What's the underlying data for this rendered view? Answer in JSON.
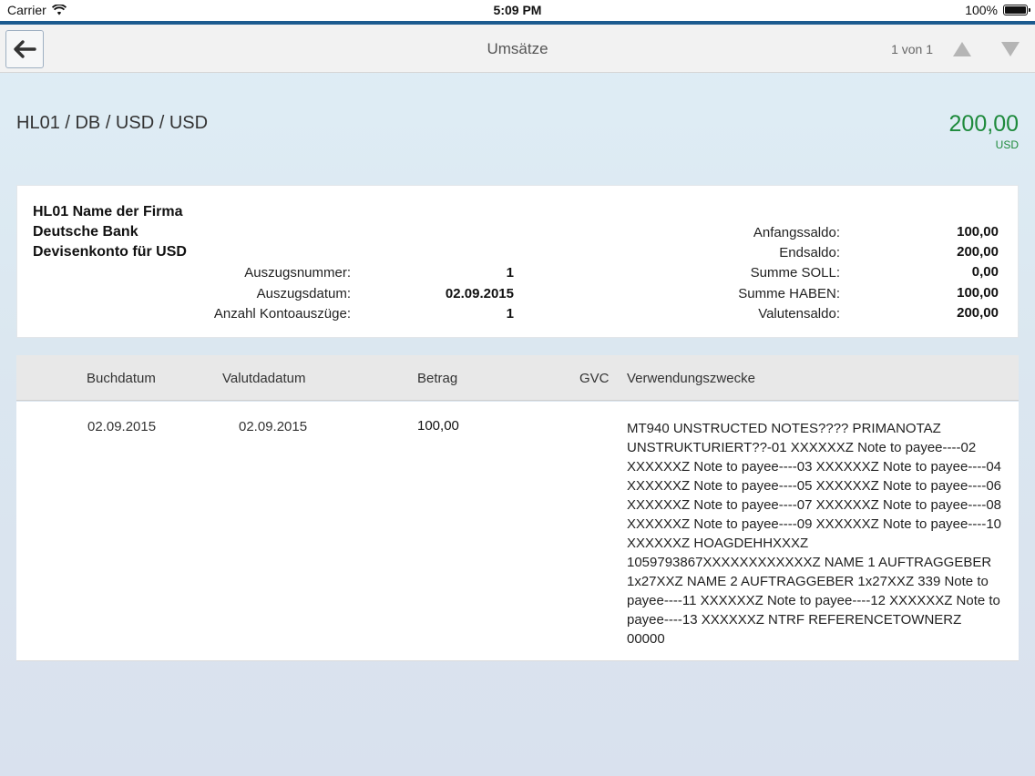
{
  "status_bar": {
    "carrier": "Carrier",
    "time": "5:09 PM",
    "battery": "100%"
  },
  "nav": {
    "title": "Umsätze",
    "pager": "1 von 1"
  },
  "header": {
    "account": "HL01 / DB / USD / USD",
    "amount": "200,00",
    "currency": "USD"
  },
  "info": {
    "firm_lines": [
      "HL01 Name der Firma",
      "Deutsche Bank",
      "Devisenkonto für USD"
    ],
    "left_fields": [
      {
        "label": "Auszugsnummer:",
        "value": "1"
      },
      {
        "label": "Auszugsdatum:",
        "value": "02.09.2015"
      },
      {
        "label": "Anzahl Kontoauszüge:",
        "value": "1"
      }
    ],
    "right_fields": [
      {
        "label": "Anfangssaldo:",
        "value": "100,00"
      },
      {
        "label": "Endsaldo:",
        "value": "200,00"
      },
      {
        "label": "Summe SOLL:",
        "value": "0,00"
      },
      {
        "label": "Summe HABEN:",
        "value": "100,00"
      },
      {
        "label": "Valutensaldo:",
        "value": "200,00"
      }
    ]
  },
  "table": {
    "columns": [
      "Buchdatum",
      "Valutdadatum",
      "Betrag",
      "GVC",
      "Verwendungszwecke"
    ],
    "rows": [
      {
        "buchdatum": "02.09.2015",
        "valutdatum": "02.09.2015",
        "betrag": "100,00",
        "gvc": "",
        "verwendungszweck": "MT940 UNSTRUCTED NOTES???? PRIMANOTAZ UNSTRUKTURIERT??-01 XXXXXXZ Note to payee----02 XXXXXXZ Note to payee----03 XXXXXXZ Note to payee----04 XXXXXXZ Note to payee----05 XXXXXXZ Note to payee----06 XXXXXXZ Note to payee----07 XXXXXXZ Note to payee----08 XXXXXXZ Note to payee----09 XXXXXXZ Note to payee----10 XXXXXXZ HOAGDEHHXXXZ 1059793867XXXXXXXXXXXXZ NAME 1 AUFTRAGGEBER 1x27XXZ NAME 2 AUFTRAGGEBER 1x27XXZ 339 Note to payee----11 XXXXXXZ Note to payee----12 XXXXXXZ Note to payee----13 XXXXXXZ NTRF REFERENCETOWNERZ 00000"
      }
    ]
  },
  "icons": {
    "back": "arrow-left-icon",
    "prev": "triangle-up-icon",
    "next": "triangle-down-icon",
    "wifi": "wifi-icon",
    "battery": "battery-icon"
  },
  "colors": {
    "accent": "#1c5b8f",
    "amount": "#1e8a3c",
    "arrows_disabled": "#b5b5b5"
  }
}
